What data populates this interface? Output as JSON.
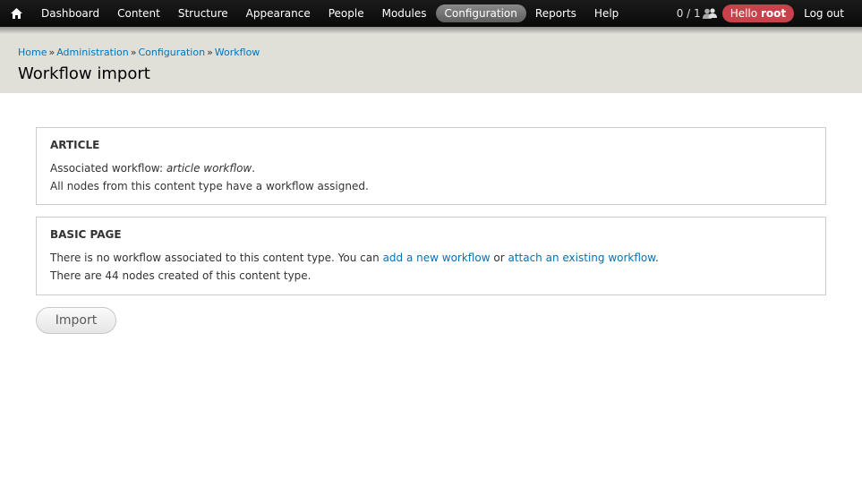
{
  "toolbar": {
    "menu": [
      {
        "label": "Dashboard",
        "active": false
      },
      {
        "label": "Content",
        "active": false
      },
      {
        "label": "Structure",
        "active": false
      },
      {
        "label": "Appearance",
        "active": false
      },
      {
        "label": "People",
        "active": false
      },
      {
        "label": "Modules",
        "active": false
      },
      {
        "label": "Configuration",
        "active": true
      },
      {
        "label": "Reports",
        "active": false
      },
      {
        "label": "Help",
        "active": false
      }
    ],
    "counter": "0 / 1",
    "hello_prefix": "Hello",
    "hello_user": "root",
    "logout": "Log out",
    "active_color": "#777777",
    "hello_color": "#c8424b"
  },
  "breadcrumb": {
    "items": [
      "Home",
      "Administration",
      "Configuration",
      "Workflow"
    ],
    "separator": "»"
  },
  "page_title": "Workflow import",
  "sections": {
    "article": {
      "legend": "ARTICLE",
      "line1_prefix": "Associated workflow:",
      "line1_workflow": "article workflow",
      "line1_suffix": ".",
      "line2": "All nodes from this content type have a workflow assigned."
    },
    "basic_page": {
      "legend": "BASIC PAGE",
      "line1_prefix": "There is no workflow associated to this content type. You can",
      "link_add": "add a new workflow",
      "line1_or": "or",
      "link_attach": "attach an existing workflow",
      "line1_suffix": ".",
      "line2": "There are 44 nodes created of this content type."
    }
  },
  "import_button": "Import",
  "icons": {
    "home": "home-icon",
    "users": "users-icon"
  },
  "colors": {
    "link": "#0074bd",
    "header_bg": "#e0e0d8",
    "toolbar_bg": "#0f0f0f"
  }
}
